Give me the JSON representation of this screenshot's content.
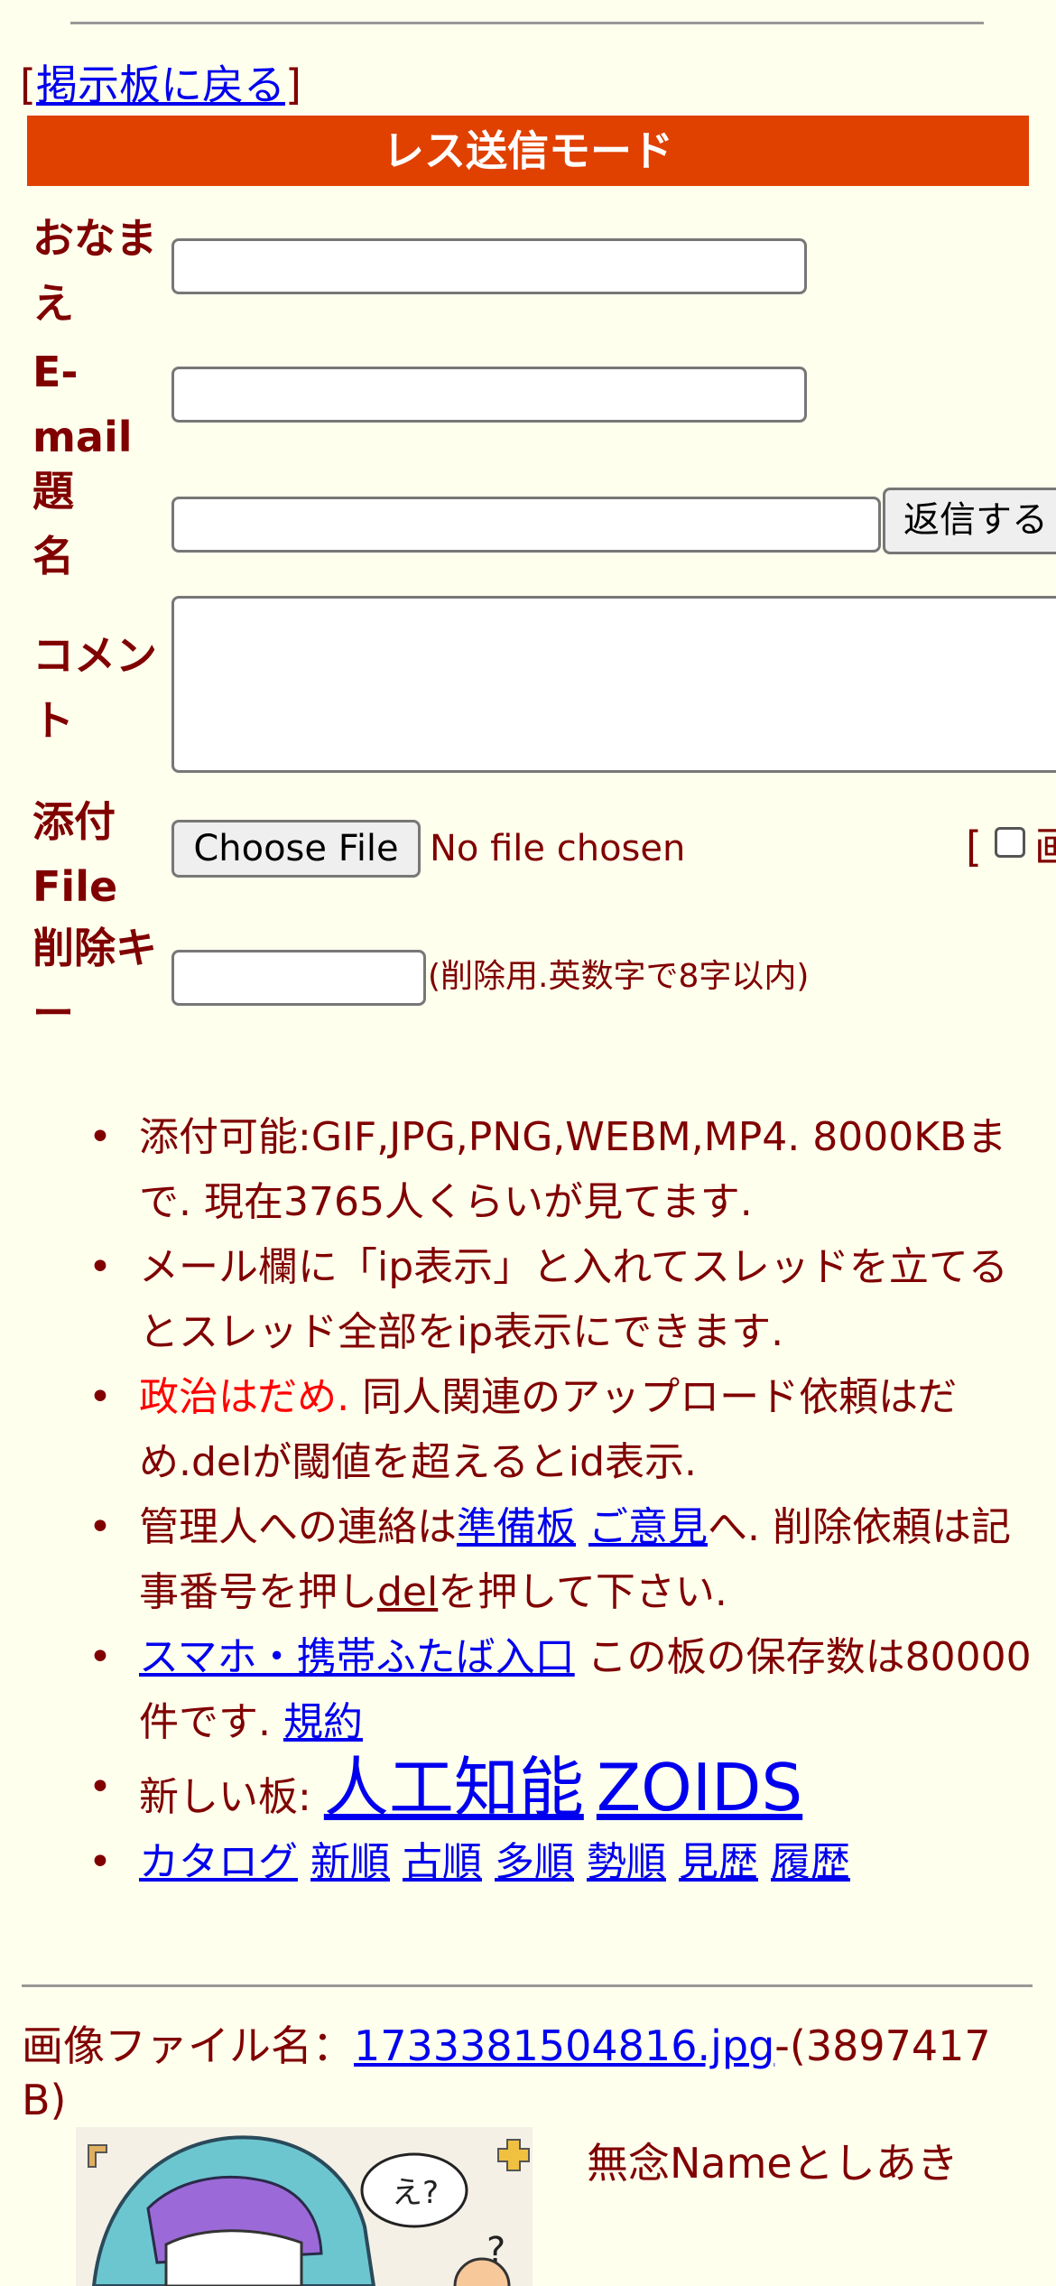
{
  "nav": {
    "bracket_open": "[",
    "back_link": "掲示板に戻る",
    "bracket_close": "]"
  },
  "form": {
    "mode_title": "レス送信モード",
    "name_label_1": "おなま",
    "name_label_2": "え",
    "name_value": "",
    "email_label_1": "E-",
    "email_label_2": "mail",
    "email_value": "",
    "subject_label_1": "題",
    "subject_label_2": "名",
    "subject_value": "",
    "submit_label": "返信する",
    "comment_label_1": "コメン",
    "comment_label_2": "ト",
    "comment_value": "",
    "attach_label_1": "添付",
    "attach_label_2": "File",
    "choose_file_label": "Choose File",
    "no_file_text": "No file chosen",
    "checkbox_bracket": "[",
    "checkbox_text": "画",
    "delkey_label_1": "削除キ",
    "delkey_label_2": "ー",
    "delkey_value": "",
    "delkey_hint": "(削除用.英数字で8字以内)"
  },
  "notes": {
    "item1": "添付可能:GIF,JPG,PNG,WEBM,MP4. 8000KBまで. 現在3765人くらいが見てます.",
    "item2": "メール欄に「ip表示」と入れてスレッドを立てるとスレッド全部をip表示にできます.",
    "item3_red": "政治はだめ.",
    "item3_rest": " 同人関連のアップロード依頼はだめ.delが閾値を超えるとid表示.",
    "item4_pre": "管理人への連絡は",
    "item4_link1": "準備板",
    "item4_space": " ",
    "item4_link2": "ご意見",
    "item4_mid": "へ. 削除依頼は記事番号を押し",
    "item4_link3": "del",
    "item4_post": "を押して下さい.",
    "item5_link": "スマホ・携帯ふたば入口",
    "item5_mid": " この板の保存数は80000件です. ",
    "item5_link2": "規約",
    "item6_pre": "新しい板: ",
    "item6_link1": "人工知能",
    "item6_link2": "ZOIDS",
    "item7_links": [
      "カタログ",
      "新順",
      "古順",
      "多順",
      "勢順",
      "見歴",
      "履歴"
    ]
  },
  "post": {
    "file_prefix": "画像ファイル名：",
    "file_link": "1733381504816.jpg",
    "file_size": "-(3897417 B)",
    "poster_text": "無念Nameとしあき"
  }
}
